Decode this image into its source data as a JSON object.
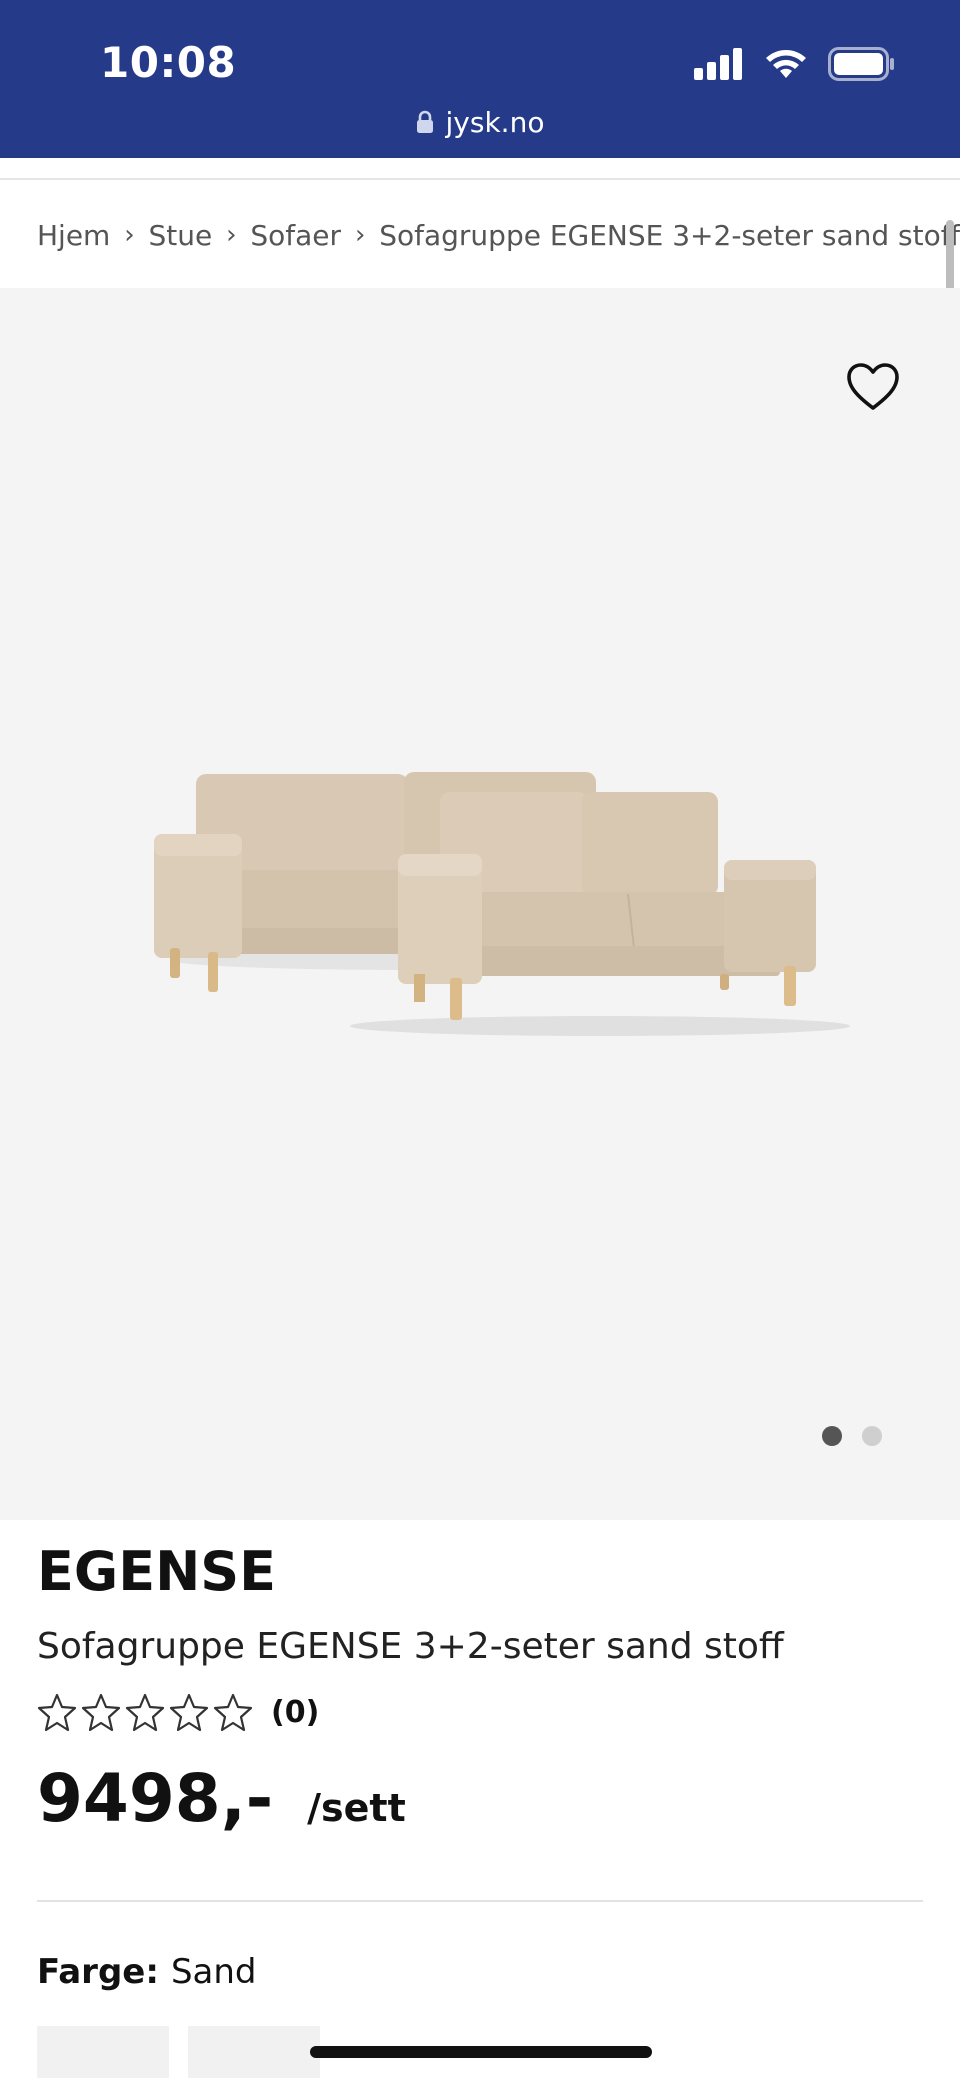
{
  "status_bar": {
    "time": "10:08",
    "icons": [
      "signal-icon",
      "wifi-icon",
      "battery-icon"
    ]
  },
  "browser": {
    "url": "jysk.no",
    "lock_icon": "lock-icon"
  },
  "breadcrumb": {
    "items": [
      "Hjem",
      "Stue",
      "Sofaer",
      "Sofagruppe EGENSE 3+2-seter sand stoff"
    ],
    "separator_icon": "chevron-right-icon"
  },
  "gallery": {
    "favorite_icon": "heart-icon",
    "image_count": 2,
    "active_image": 1,
    "colors": {
      "background": "#f4f4f4",
      "dot_active": "#555555",
      "dot_inactive": "#cfcfcf"
    }
  },
  "product": {
    "brand": "EGENSE",
    "title": "Sofagruppe EGENSE 3+2-seter sand stoff",
    "rating": {
      "stars_filled": 0,
      "stars_total": 5,
      "count_label": "(0)"
    },
    "price": "9498,-",
    "unit": "/sett",
    "color_label": "Farge:",
    "color_value": "Sand"
  },
  "theme": {
    "brand_blue": "#263a8a",
    "sofa_fabric": "#d8c8b3"
  }
}
